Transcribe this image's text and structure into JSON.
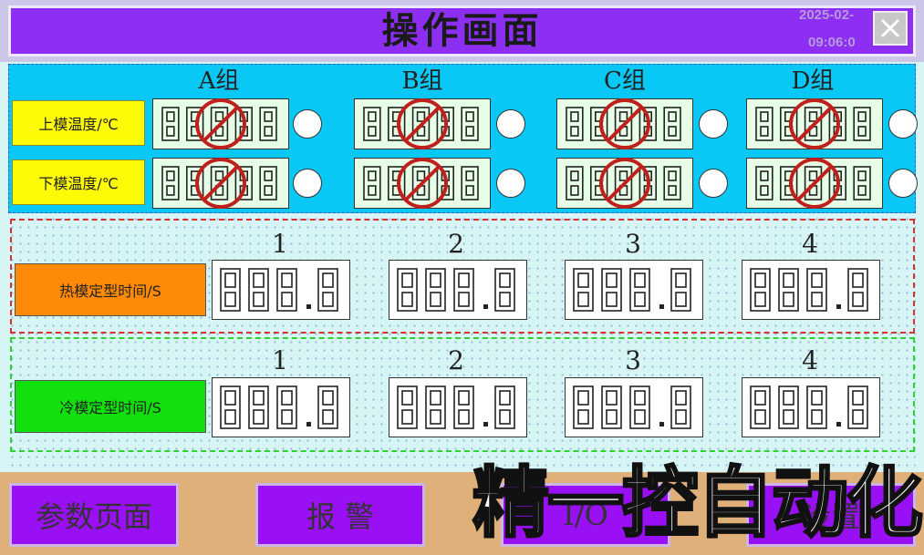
{
  "header": {
    "title": "操作画面",
    "date": "2025-02-",
    "time": "09:06:0"
  },
  "temperature": {
    "groups": [
      "A组",
      "B组",
      "C组",
      "D组"
    ],
    "rows": [
      {
        "label": "上模温度/℃"
      },
      {
        "label": "下模温度/℃"
      }
    ]
  },
  "hot_mold": {
    "label": "热模定型时间/S",
    "columns": [
      "1",
      "2",
      "3",
      "4"
    ],
    "values": [
      "000.0",
      "000.0",
      "000.0",
      "000.0"
    ]
  },
  "cold_mold": {
    "label": "冷模定型时间/S",
    "columns": [
      "1",
      "2",
      "3",
      "4"
    ],
    "values": [
      "000.0",
      "000.0",
      "000.0",
      "000.0"
    ]
  },
  "nav": {
    "params": "参数页面",
    "alarm": "报 警",
    "io": "I/O",
    "fourth": "设置"
  },
  "watermark": "精一控自动化",
  "colors": {
    "title_bg": "#8d2ef3",
    "temp_panel_bg": "#0ac8f5",
    "temp_label_bg": "#fdfb06",
    "hot_label_bg": "#ff8a08",
    "cold_label_bg": "#12e00c",
    "hot_border": "#d93030",
    "cold_border": "#2ed42e",
    "nav_btn_bg": "#9810f3",
    "forbidden_red": "#c0201c"
  }
}
